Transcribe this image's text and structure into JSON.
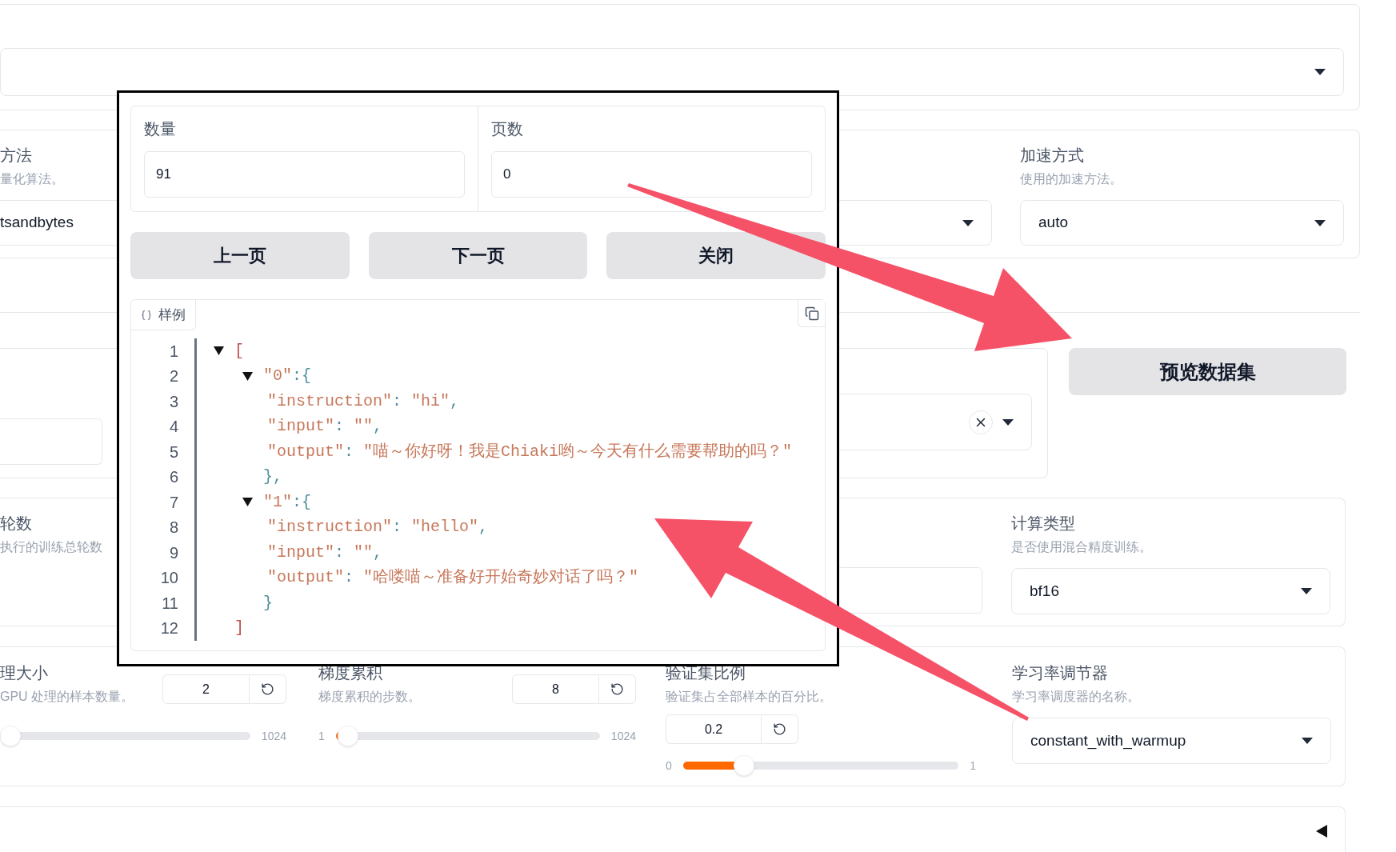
{
  "quantization": {
    "label": "方法",
    "description": "量化算法。",
    "value": "tsandbytes"
  },
  "acceleration": {
    "label": "加速方式",
    "description": "使用的加速方法。",
    "value": "auto"
  },
  "preview_button": "预览数据集",
  "epochs": {
    "label": "轮数",
    "description": "执行的训练总轮数"
  },
  "compute_type": {
    "label": "计算类型",
    "description": "是否使用混合精度训练。",
    "value": "bf16"
  },
  "sliders": [
    {
      "kind": "inline",
      "label": "理大小",
      "description": "GPU 处理的样本数量。",
      "value": "2",
      "max": "1024",
      "level": 0.0
    },
    {
      "kind": "inline",
      "label": "梯度累积",
      "description": "梯度累积的步数。",
      "value": "8",
      "min": "1",
      "max": "1024",
      "level": 0.007
    },
    {
      "kind": "stacked",
      "label": "验证集比例",
      "description": "验证集占全部样本的百分比。",
      "value": "0.2",
      "min": "0",
      "max": "1",
      "level": 0.2
    }
  ],
  "scheduler": {
    "label": "学习率调节器",
    "description": "学习率调度器的名称。",
    "value": "constant_with_warmup"
  },
  "modal": {
    "fields": [
      {
        "label": "数量",
        "value": "91"
      },
      {
        "label": "页数",
        "value": "0"
      }
    ],
    "buttons": [
      "上一页",
      "下一页",
      "关闭"
    ],
    "code_view": {
      "tab": "样例",
      "tree": [
        {
          "line": "1",
          "text": "[",
          "expanded": true,
          "children": [
            {
              "line": "2",
              "text": "\"0\":{",
              "expanded": true,
              "children": [
                {
                  "line": "3",
                  "text": "\"instruction\": \"hi\","
                },
                {
                  "line": "4",
                  "text": "\"input\": \"\","
                },
                {
                  "line": "5",
                  "text": "\"output\": \"喵～你好呀！我是Chiaki哟～今天有什么需要帮助的吗？\""
                }
              ],
              "close": {
                "line": "6",
                "text": "},"
              }
            },
            {
              "line": "7",
              "text": "\"1\":{",
              "expanded": true,
              "children": [
                {
                  "line": "8",
                  "text": "\"instruction\": \"hello\","
                },
                {
                  "line": "9",
                  "text": "\"input\": \"\","
                },
                {
                  "line": "10",
                  "text": "\"output\": \"哈喽喵～准备好开始奇妙对话了吗？\""
                }
              ],
              "close": {
                "line": "11",
                "text": "}"
              }
            }
          ],
          "close": {
            "line": "12",
            "text": "]"
          }
        }
      ]
    }
  }
}
